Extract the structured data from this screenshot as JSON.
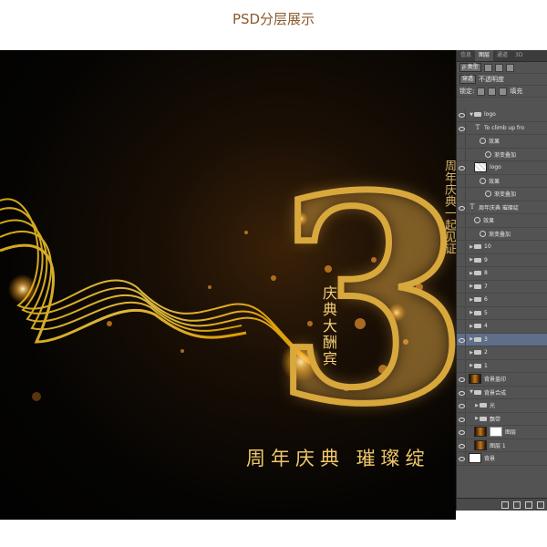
{
  "page_title": "PSD分层展示",
  "poster": {
    "big_number": "3",
    "vertical_text": "庆典大酬宾",
    "bottom_slogan": "周年庆典  璀璨绽",
    "right_vertical_text": "周年庆典一起见证"
  },
  "panel": {
    "tabs": [
      "信息",
      "图层",
      "通道",
      "3D"
    ],
    "active_tab": "图层",
    "kind_filter": "ρ 类型",
    "blend_mode": "穿透",
    "opacity_label": "不透明度",
    "lock_label": "锁定:",
    "fill_label": "填充"
  },
  "layers": [
    {
      "type": "folder",
      "name": "logo",
      "indent": 0,
      "expanded": true,
      "visible": true
    },
    {
      "type": "text",
      "name": "To climb up fro",
      "indent": 1,
      "visible": true
    },
    {
      "type": "effect",
      "name": "效果",
      "indent": 2,
      "visible": false
    },
    {
      "type": "effect-item",
      "name": "渐变叠加",
      "indent": 3,
      "visible": false
    },
    {
      "type": "image",
      "name": "logo",
      "indent": 1,
      "thumb": "checker",
      "visible": true
    },
    {
      "type": "effect",
      "name": "效果",
      "indent": 2,
      "visible": false
    },
    {
      "type": "effect-item",
      "name": "渐变叠加",
      "indent": 3,
      "visible": false
    },
    {
      "type": "text",
      "name": "周年庆典  璀璨绽",
      "indent": 0,
      "visible": true
    },
    {
      "type": "effect",
      "name": "效果",
      "indent": 1,
      "visible": false
    },
    {
      "type": "effect-item",
      "name": "渐变叠加",
      "indent": 2,
      "visible": false
    },
    {
      "type": "folder",
      "name": "10",
      "indent": 0,
      "expanded": false,
      "visible": false
    },
    {
      "type": "folder",
      "name": "9",
      "indent": 0,
      "expanded": false,
      "visible": false
    },
    {
      "type": "folder",
      "name": "8",
      "indent": 0,
      "expanded": false,
      "visible": false
    },
    {
      "type": "folder",
      "name": "7",
      "indent": 0,
      "expanded": false,
      "visible": false
    },
    {
      "type": "folder",
      "name": "6",
      "indent": 0,
      "expanded": false,
      "visible": false
    },
    {
      "type": "folder",
      "name": "5",
      "indent": 0,
      "expanded": false,
      "visible": false
    },
    {
      "type": "folder",
      "name": "4",
      "indent": 0,
      "expanded": false,
      "visible": false
    },
    {
      "type": "folder",
      "name": "3",
      "indent": 0,
      "expanded": false,
      "visible": true,
      "selected": true
    },
    {
      "type": "folder",
      "name": "2",
      "indent": 0,
      "expanded": false,
      "visible": false
    },
    {
      "type": "folder",
      "name": "1",
      "indent": 0,
      "expanded": false,
      "visible": false
    },
    {
      "type": "image",
      "name": "背景盖印",
      "indent": 0,
      "thumb": "dark",
      "visible": true
    },
    {
      "type": "folder",
      "name": "背景合成",
      "indent": 0,
      "expanded": true,
      "visible": true
    },
    {
      "type": "folder",
      "name": "光",
      "indent": 1,
      "expanded": false,
      "visible": true
    },
    {
      "type": "folder",
      "name": "飘带",
      "indent": 1,
      "expanded": false,
      "visible": true
    },
    {
      "type": "image",
      "name": "图层",
      "indent": 1,
      "thumb": "dark",
      "mask": true,
      "visible": true
    },
    {
      "type": "image",
      "name": "图层 1",
      "indent": 1,
      "thumb": "dark",
      "visible": true
    },
    {
      "type": "image",
      "name": "背景",
      "indent": 0,
      "thumb": "white",
      "visible": true
    }
  ]
}
